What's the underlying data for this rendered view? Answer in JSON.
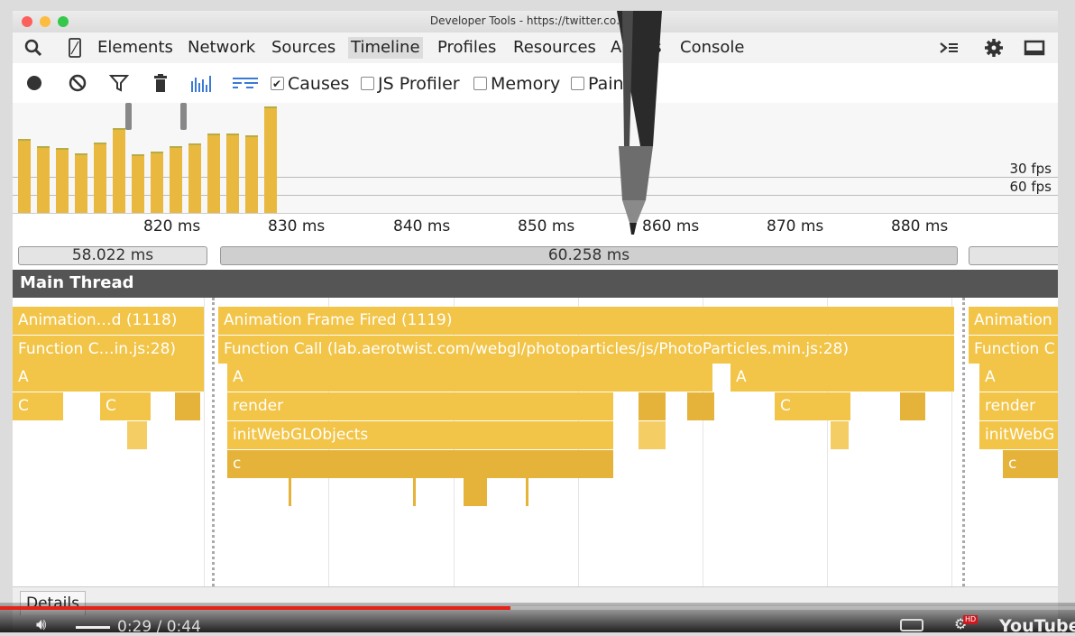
{
  "window": {
    "title": "Developer Tools - https://twitter.co…an"
  },
  "tabs": [
    {
      "label": "Elements"
    },
    {
      "label": "Network"
    },
    {
      "label": "Sources"
    },
    {
      "label": "Timeline"
    },
    {
      "label": "Profiles"
    },
    {
      "label": "Resources"
    },
    {
      "label": "Audits"
    },
    {
      "label": "Console"
    }
  ],
  "toolbar": {
    "causes": {
      "label": "Causes",
      "checked": true
    },
    "js_profiler": {
      "label": "JS Profiler",
      "checked": false
    },
    "memory": {
      "label": "Memory",
      "checked": false
    },
    "paint": {
      "label": "Paint",
      "checked": false
    }
  },
  "overview": {
    "fps_30": "30 fps",
    "fps_60": "60 fps"
  },
  "ruler": {
    "ticks": [
      "820 ms",
      "830 ms",
      "840 ms",
      "850 ms",
      "860 ms",
      "870 ms",
      "880 ms"
    ]
  },
  "frames": [
    {
      "label": "58.022 ms"
    },
    {
      "label": "60.258 ms"
    },
    {
      "label": ""
    }
  ],
  "thread": {
    "title": "Main Thread"
  },
  "flame": {
    "left": {
      "animation": "Animation…d (1118)",
      "function": "Function C…in.js:28)",
      "a": "A",
      "c1": "C",
      "c2": "C"
    },
    "middle": {
      "animation": "Animation Frame Fired (1119)",
      "function": "Function Call (lab.aerotwist.com/webgl/photoparticles/js/PhotoParticles.min.js:28)",
      "a1": "A",
      "a2": "A",
      "render": "render",
      "c": "C",
      "init": "initWebGLObjects",
      "c_lower": "c"
    },
    "right": {
      "animation": "Animation",
      "function": "Function C",
      "a": "A",
      "render": "render",
      "init": "initWebG",
      "c": "c"
    }
  },
  "details": {
    "label": "Details"
  },
  "video": {
    "progress": 0.475,
    "time": "0:29 / 0:44",
    "logo": "YouTube",
    "colors": {
      "progress": "#e62117"
    }
  },
  "colors": {
    "scripting": "#f2c447",
    "thread_header": "#555555",
    "close_light": "#fc605c",
    "minimize_light": "#fdbc40",
    "zoom_light": "#34c84a"
  }
}
